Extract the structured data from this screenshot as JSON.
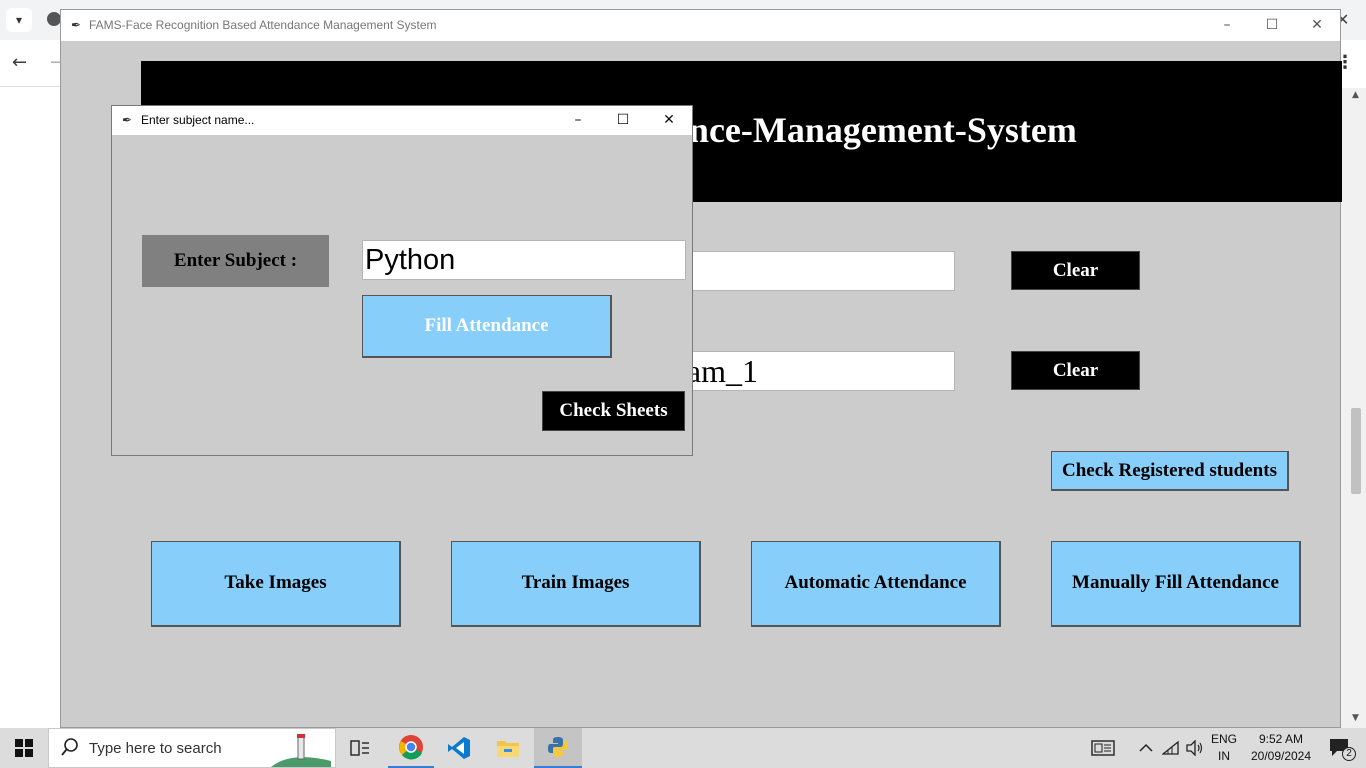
{
  "main_window": {
    "title": "FAMS-Face Recognition Based Attendance Management System",
    "header_text": "Face-Recognition-Based-Attendance-Management-System",
    "entry_1_value": "",
    "entry_2_value": "Pradeep Kumar Rajam_1",
    "clear_label": "Clear",
    "check_registered_label": "Check Registered students",
    "take_images_label": "Take Images",
    "train_images_label": "Train Images",
    "automatic_attendance_label": "Automatic Attendance",
    "manual_fill_label": "Manually Fill Attendance"
  },
  "dialog": {
    "title": "Enter subject name...",
    "subject_label": "Enter Subject :",
    "subject_value": "Python",
    "fill_attendance_label": "Fill Attendance",
    "check_sheets_label": "Check Sheets"
  },
  "taskbar": {
    "search_placeholder": "Type here to search",
    "language": "ENG",
    "region": "IN",
    "time": "9:52 AM",
    "date": "20/09/2024",
    "notification_count": "2"
  },
  "colors": {
    "window_bg": "#cccccc",
    "header_bg": "#000000",
    "header_text": "#ffffff",
    "button_blue": "#87cefa",
    "button_black": "#000000",
    "label_gray": "#808080"
  },
  "icons": [
    "windows-start-icon",
    "search-icon",
    "task-view-icon",
    "chrome-icon",
    "vscode-icon",
    "file-explorer-icon",
    "python-icon",
    "news-icon",
    "chevron-up-icon",
    "network-icon",
    "volume-icon",
    "notification-icon",
    "feather-icon"
  ]
}
